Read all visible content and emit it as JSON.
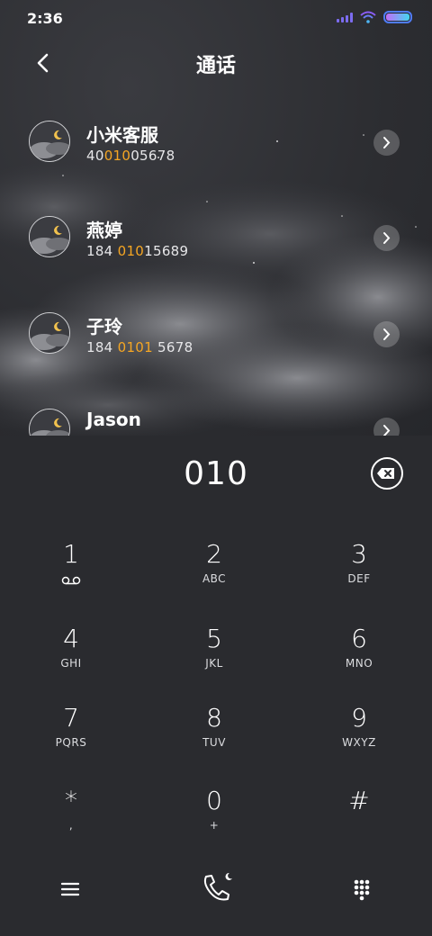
{
  "status_bar": {
    "time": "2:36"
  },
  "header": {
    "title": "通话"
  },
  "contacts": [
    {
      "name": "小米客服",
      "number_prefix": "40",
      "number_match": "010",
      "number_suffix": "05678"
    },
    {
      "name": "燕婷",
      "number_prefix": "184 ",
      "number_match": "010",
      "number_suffix": "15689"
    },
    {
      "name": "子玲",
      "number_prefix": "184 ",
      "number_match": "0101",
      "number_suffix": " 5678"
    },
    {
      "name": "Jason",
      "number_prefix": "",
      "number_match": "",
      "number_suffix": ""
    }
  ],
  "dialer": {
    "input_value": "010"
  },
  "keypad": [
    {
      "digit": "1",
      "letters": ""
    },
    {
      "digit": "2",
      "letters": "ABC"
    },
    {
      "digit": "3",
      "letters": "DEF"
    },
    {
      "digit": "4",
      "letters": "GHI"
    },
    {
      "digit": "5",
      "letters": "JKL"
    },
    {
      "digit": "6",
      "letters": "MNO"
    },
    {
      "digit": "7",
      "letters": "PQRS"
    },
    {
      "digit": "8",
      "letters": "TUV"
    },
    {
      "digit": "9",
      "letters": "WXYZ"
    },
    {
      "digit": "*",
      "letters": ","
    },
    {
      "digit": "0",
      "letters": "+"
    },
    {
      "digit": "#",
      "letters": ""
    }
  ],
  "colors": {
    "highlight": "#f5a623",
    "background": "#2a2b2f"
  }
}
